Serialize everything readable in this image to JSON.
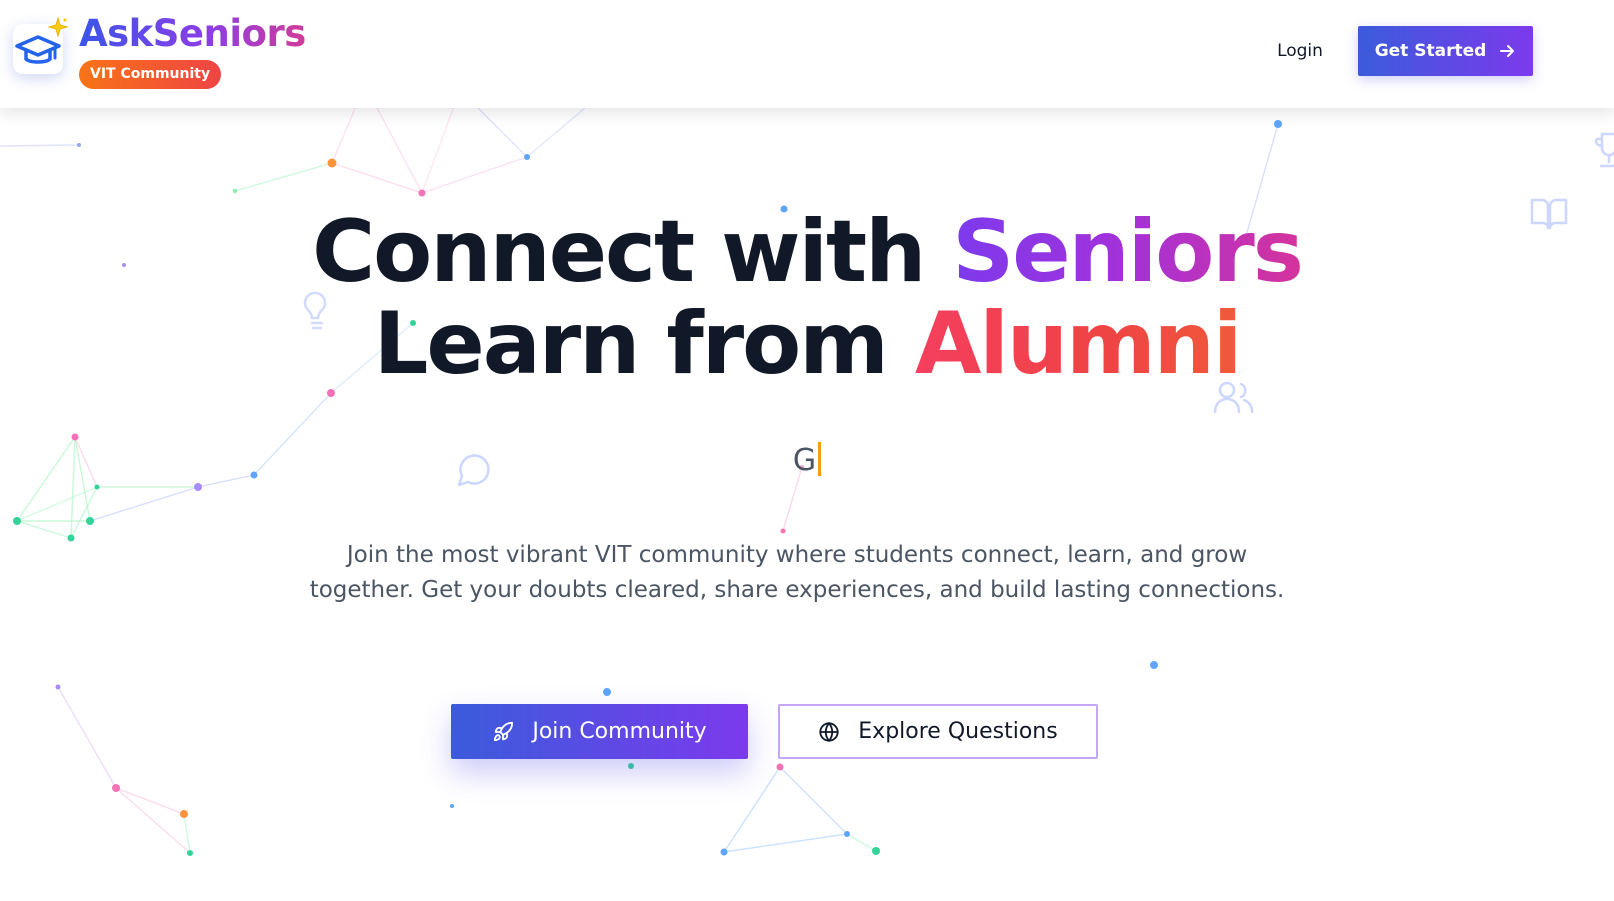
{
  "header": {
    "brand_name": "AskSeniors",
    "brand_badge": "VIT Community",
    "login_label": "Login",
    "get_started_label": "Get Started"
  },
  "hero": {
    "line1_plain": "Connect with ",
    "line1_accent": "Seniors",
    "line2_plain": "Learn from ",
    "line2_accent": "Alumni",
    "typing_text": "G",
    "subtitle": "Join the most vibrant VIT community where students connect, learn, and grow together. Get your doubts cleared, share experiences, and build lasting connections."
  },
  "actions": {
    "join_label": "Join Community",
    "explore_label": "Explore Questions"
  },
  "icons": {
    "logo": "graduation-cap-icon",
    "logo_accent": "sparkle-icon",
    "get_started": "arrow-right-icon",
    "join": "rocket-icon",
    "explore": "globe-icon",
    "bg_decor": [
      "lightbulb-icon",
      "message-circle-icon",
      "users-icon",
      "book-open-icon",
      "trophy-icon"
    ]
  },
  "colors": {
    "brand_blue": "#3b5bdb",
    "brand_purple": "#7c3aed",
    "brand_pink": "#d6339b",
    "accent_red": "#ef4444",
    "accent_orange": "#f97316",
    "text_dark": "#111827",
    "text_muted": "#4b5563",
    "caret": "#f59e0b"
  }
}
